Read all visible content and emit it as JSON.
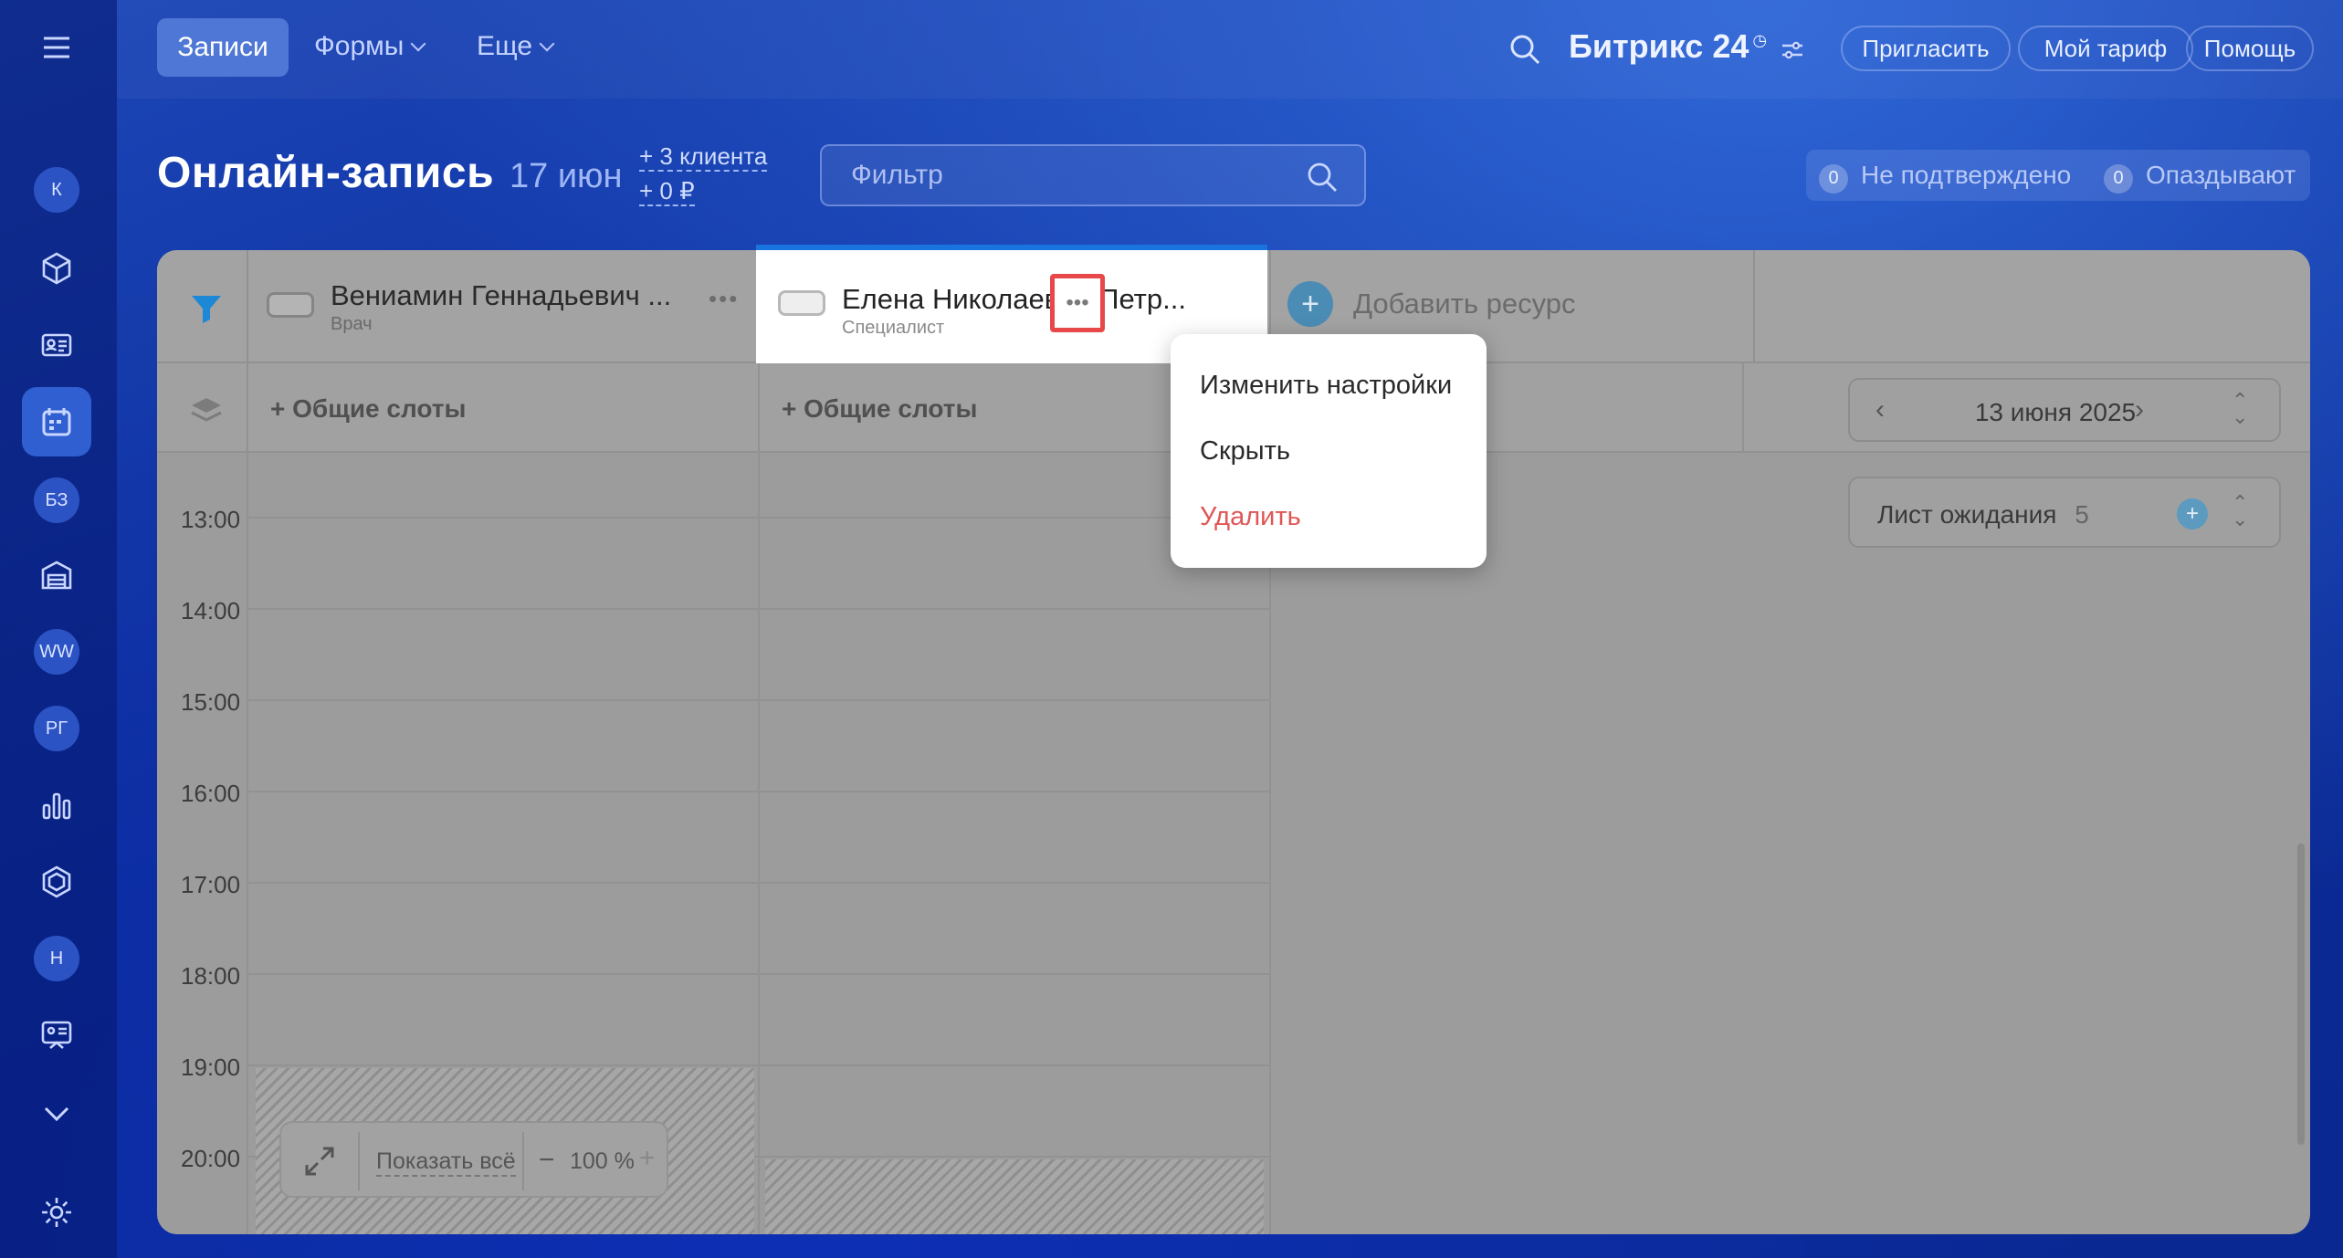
{
  "topbar": {
    "tabs": [
      {
        "label": "Записи",
        "active": true
      },
      {
        "label": "Формы"
      },
      {
        "label": "Еще"
      }
    ],
    "brand": "Битрикс 24",
    "buttons": [
      "Пригласить",
      "Мой тариф",
      "Помощь"
    ]
  },
  "sidebar": {
    "avatars": [
      "К",
      "БЗ",
      "WW",
      "РГ",
      "Н"
    ]
  },
  "header": {
    "title": "Онлайн-запись",
    "date": "17 июн",
    "clients": "+ 3 клиента",
    "revenue": "+ 0 ₽",
    "filter_placeholder": "Фильтр",
    "unconfirmed_count": "0",
    "unconfirmed_label": "Не подтверждено",
    "late_count": "0",
    "late_label": "Опаздывают"
  },
  "resources": [
    {
      "name": "Вениамин Геннадьевич ...",
      "role": "Врач"
    },
    {
      "name": "Елена Николаевна Петр...",
      "role": "Специалист"
    }
  ],
  "add_resource": "Добавить ресурс",
  "slots_label": "+ Общие слоты",
  "calendar": {
    "date": "13 июня 2025",
    "waitlist_label": "Лист ожидания",
    "waitlist_count": "5"
  },
  "times": [
    "13:00",
    "14:00",
    "15:00",
    "16:00",
    "17:00",
    "18:00",
    "19:00",
    "20:00"
  ],
  "zoom": {
    "show_all": "Показать всё",
    "level": "100 %"
  },
  "context_menu": {
    "items": [
      {
        "label": "Изменить настройки"
      },
      {
        "label": "Скрыть"
      },
      {
        "label": "Удалить",
        "danger": true
      }
    ]
  },
  "colors": {
    "accent": "#1a74e0",
    "danger": "#e05656",
    "highlight": "#e8484a"
  }
}
